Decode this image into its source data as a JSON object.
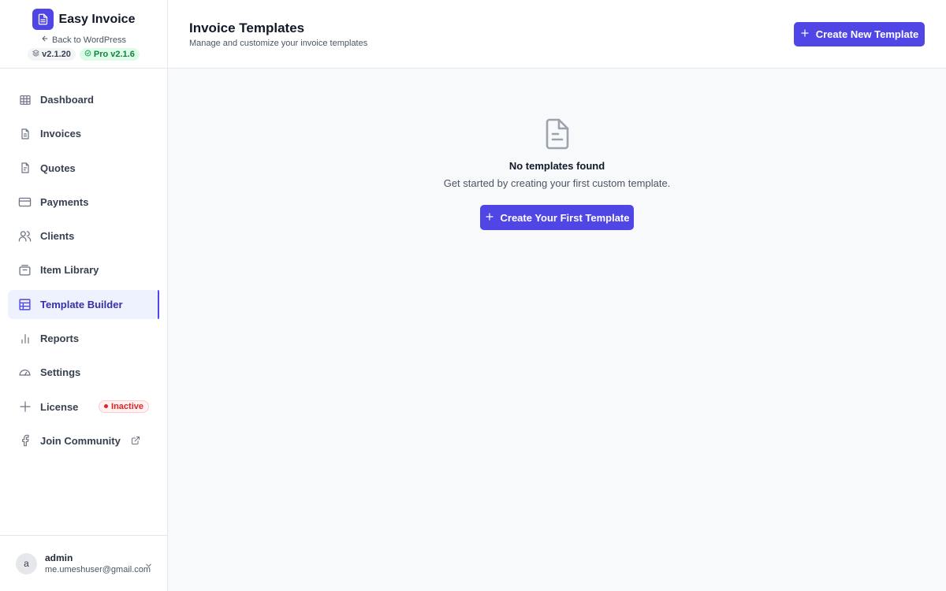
{
  "brand": {
    "name": "Easy Invoice",
    "back_link": "Back to WordPress",
    "version": "v2.1.20",
    "pro_version": "Pro v2.1.6"
  },
  "nav": [
    {
      "label": "Dashboard",
      "icon": "grid-icon"
    },
    {
      "label": "Invoices",
      "icon": "document-icon"
    },
    {
      "label": "Quotes",
      "icon": "document-icon"
    },
    {
      "label": "Payments",
      "icon": "credit-card-icon"
    },
    {
      "label": "Clients",
      "icon": "users-icon"
    },
    {
      "label": "Item Library",
      "icon": "library-icon"
    },
    {
      "label": "Template Builder",
      "icon": "template-icon",
      "active": true
    },
    {
      "label": "Reports",
      "icon": "bar-chart-icon"
    },
    {
      "label": "Settings",
      "icon": "gauge-icon"
    },
    {
      "label": "License",
      "icon": "sparkle-icon",
      "badge": "Inactive"
    },
    {
      "label": "Join Community",
      "icon": "facebook-icon"
    }
  ],
  "user": {
    "avatar_initial": "a",
    "name": "admin",
    "email": "me.umeshuser@gmail.com"
  },
  "header": {
    "title": "Invoice Templates",
    "subtitle": "Manage and customize your invoice templates",
    "create_button": "Create New Template"
  },
  "empty_state": {
    "title": "No templates found",
    "subtitle": "Get started by creating your first custom template.",
    "button": "Create Your First Template"
  },
  "colors": {
    "accent": "#4f46e5",
    "active_bg": "#eef2ff",
    "pro_badge_bg": "#dcfce7",
    "inactive_red": "#dc2626"
  }
}
